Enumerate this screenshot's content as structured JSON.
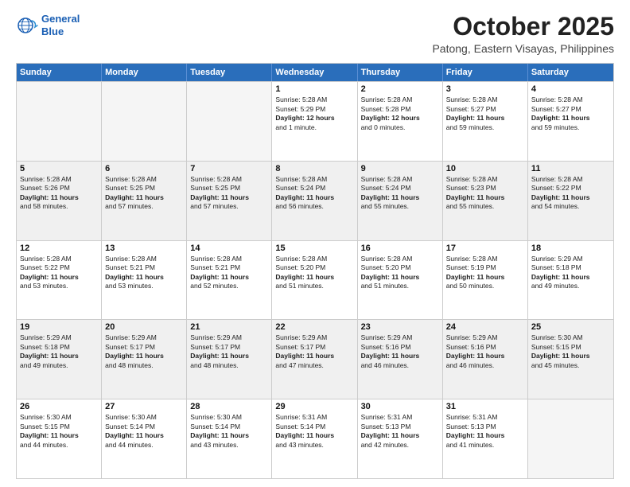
{
  "header": {
    "logo_line1": "General",
    "logo_line2": "Blue",
    "month": "October 2025",
    "location": "Patong, Eastern Visayas, Philippines"
  },
  "days_of_week": [
    "Sunday",
    "Monday",
    "Tuesday",
    "Wednesday",
    "Thursday",
    "Friday",
    "Saturday"
  ],
  "weeks": [
    [
      {
        "day": "",
        "info": "",
        "empty": true
      },
      {
        "day": "",
        "info": "",
        "empty": true
      },
      {
        "day": "",
        "info": "",
        "empty": true
      },
      {
        "day": "1",
        "info": "Sunrise: 5:28 AM\nSunset: 5:29 PM\nDaylight: 12 hours\nand 1 minute.",
        "empty": false
      },
      {
        "day": "2",
        "info": "Sunrise: 5:28 AM\nSunset: 5:28 PM\nDaylight: 12 hours\nand 0 minutes.",
        "empty": false
      },
      {
        "day": "3",
        "info": "Sunrise: 5:28 AM\nSunset: 5:27 PM\nDaylight: 11 hours\nand 59 minutes.",
        "empty": false
      },
      {
        "day": "4",
        "info": "Sunrise: 5:28 AM\nSunset: 5:27 PM\nDaylight: 11 hours\nand 59 minutes.",
        "empty": false
      }
    ],
    [
      {
        "day": "5",
        "info": "Sunrise: 5:28 AM\nSunset: 5:26 PM\nDaylight: 11 hours\nand 58 minutes.",
        "empty": false
      },
      {
        "day": "6",
        "info": "Sunrise: 5:28 AM\nSunset: 5:25 PM\nDaylight: 11 hours\nand 57 minutes.",
        "empty": false
      },
      {
        "day": "7",
        "info": "Sunrise: 5:28 AM\nSunset: 5:25 PM\nDaylight: 11 hours\nand 57 minutes.",
        "empty": false
      },
      {
        "day": "8",
        "info": "Sunrise: 5:28 AM\nSunset: 5:24 PM\nDaylight: 11 hours\nand 56 minutes.",
        "empty": false
      },
      {
        "day": "9",
        "info": "Sunrise: 5:28 AM\nSunset: 5:24 PM\nDaylight: 11 hours\nand 55 minutes.",
        "empty": false
      },
      {
        "day": "10",
        "info": "Sunrise: 5:28 AM\nSunset: 5:23 PM\nDaylight: 11 hours\nand 55 minutes.",
        "empty": false
      },
      {
        "day": "11",
        "info": "Sunrise: 5:28 AM\nSunset: 5:22 PM\nDaylight: 11 hours\nand 54 minutes.",
        "empty": false
      }
    ],
    [
      {
        "day": "12",
        "info": "Sunrise: 5:28 AM\nSunset: 5:22 PM\nDaylight: 11 hours\nand 53 minutes.",
        "empty": false
      },
      {
        "day": "13",
        "info": "Sunrise: 5:28 AM\nSunset: 5:21 PM\nDaylight: 11 hours\nand 53 minutes.",
        "empty": false
      },
      {
        "day": "14",
        "info": "Sunrise: 5:28 AM\nSunset: 5:21 PM\nDaylight: 11 hours\nand 52 minutes.",
        "empty": false
      },
      {
        "day": "15",
        "info": "Sunrise: 5:28 AM\nSunset: 5:20 PM\nDaylight: 11 hours\nand 51 minutes.",
        "empty": false
      },
      {
        "day": "16",
        "info": "Sunrise: 5:28 AM\nSunset: 5:20 PM\nDaylight: 11 hours\nand 51 minutes.",
        "empty": false
      },
      {
        "day": "17",
        "info": "Sunrise: 5:28 AM\nSunset: 5:19 PM\nDaylight: 11 hours\nand 50 minutes.",
        "empty": false
      },
      {
        "day": "18",
        "info": "Sunrise: 5:29 AM\nSunset: 5:18 PM\nDaylight: 11 hours\nand 49 minutes.",
        "empty": false
      }
    ],
    [
      {
        "day": "19",
        "info": "Sunrise: 5:29 AM\nSunset: 5:18 PM\nDaylight: 11 hours\nand 49 minutes.",
        "empty": false
      },
      {
        "day": "20",
        "info": "Sunrise: 5:29 AM\nSunset: 5:17 PM\nDaylight: 11 hours\nand 48 minutes.",
        "empty": false
      },
      {
        "day": "21",
        "info": "Sunrise: 5:29 AM\nSunset: 5:17 PM\nDaylight: 11 hours\nand 48 minutes.",
        "empty": false
      },
      {
        "day": "22",
        "info": "Sunrise: 5:29 AM\nSunset: 5:17 PM\nDaylight: 11 hours\nand 47 minutes.",
        "empty": false
      },
      {
        "day": "23",
        "info": "Sunrise: 5:29 AM\nSunset: 5:16 PM\nDaylight: 11 hours\nand 46 minutes.",
        "empty": false
      },
      {
        "day": "24",
        "info": "Sunrise: 5:29 AM\nSunset: 5:16 PM\nDaylight: 11 hours\nand 46 minutes.",
        "empty": false
      },
      {
        "day": "25",
        "info": "Sunrise: 5:30 AM\nSunset: 5:15 PM\nDaylight: 11 hours\nand 45 minutes.",
        "empty": false
      }
    ],
    [
      {
        "day": "26",
        "info": "Sunrise: 5:30 AM\nSunset: 5:15 PM\nDaylight: 11 hours\nand 44 minutes.",
        "empty": false
      },
      {
        "day": "27",
        "info": "Sunrise: 5:30 AM\nSunset: 5:14 PM\nDaylight: 11 hours\nand 44 minutes.",
        "empty": false
      },
      {
        "day": "28",
        "info": "Sunrise: 5:30 AM\nSunset: 5:14 PM\nDaylight: 11 hours\nand 43 minutes.",
        "empty": false
      },
      {
        "day": "29",
        "info": "Sunrise: 5:31 AM\nSunset: 5:14 PM\nDaylight: 11 hours\nand 43 minutes.",
        "empty": false
      },
      {
        "day": "30",
        "info": "Sunrise: 5:31 AM\nSunset: 5:13 PM\nDaylight: 11 hours\nand 42 minutes.",
        "empty": false
      },
      {
        "day": "31",
        "info": "Sunrise: 5:31 AM\nSunset: 5:13 PM\nDaylight: 11 hours\nand 41 minutes.",
        "empty": false
      },
      {
        "day": "",
        "info": "",
        "empty": true
      }
    ]
  ]
}
